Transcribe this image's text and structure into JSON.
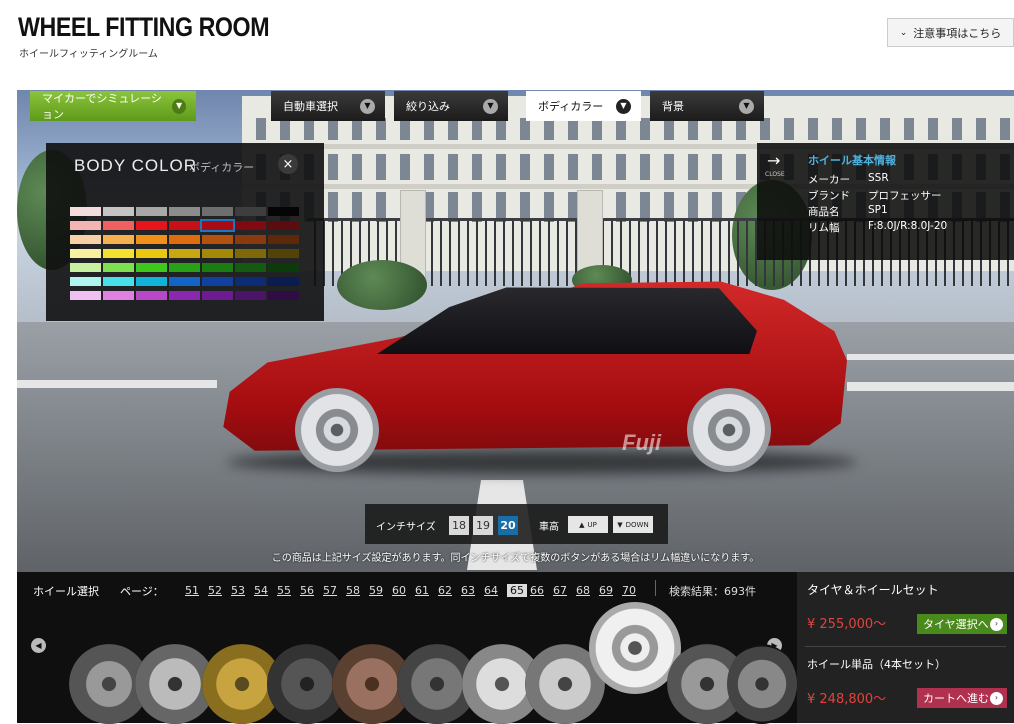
{
  "header": {
    "title": "WHEEL FITTING ROOM",
    "subtitle": "ホイールフィッティングルーム",
    "notice_button": "注意事項はこちら"
  },
  "nav": {
    "my_car_sim": "マイカーでシミュレーション",
    "tabs": [
      {
        "label": "自動車選択"
      },
      {
        "label": "絞り込み"
      },
      {
        "label": "ボディカラー",
        "active": true
      },
      {
        "label": "背景"
      }
    ]
  },
  "body_color": {
    "title": "BODY COLOR",
    "subtitle": "ボディカラー",
    "close": "×",
    "swatches": [
      [
        "#f2dcdc",
        "#c4c4c4",
        "#a8a8a8",
        "#8c8c8c",
        "#6e6e6e",
        "#3e3e3e",
        "#050505"
      ],
      [
        "#f4b4b4",
        "#f06060",
        "#e8141c",
        "#c8101a",
        "#a80c12",
        "#800a10",
        "#5a0c0e"
      ],
      [
        "#f8d0a8",
        "#f6b050",
        "#f09018",
        "#e06c10",
        "#b45010",
        "#8a3a0c",
        "#5e280a"
      ],
      [
        "#f8f0a0",
        "#f4e030",
        "#e8c810",
        "#c8a810",
        "#a48808",
        "#7e6808",
        "#524408"
      ],
      [
        "#c8f0a0",
        "#7ee050",
        "#3cc81c",
        "#28a018",
        "#1c7c14",
        "#145a10",
        "#0c3a0a"
      ],
      [
        "#b0f4f0",
        "#48e0e8",
        "#10b4d8",
        "#1464c8",
        "#1040a0",
        "#0c2c78",
        "#0a1c50"
      ],
      [
        "#f0c0f0",
        "#e080e0",
        "#b848c8",
        "#8c28b0",
        "#6c1c90",
        "#4c1468",
        "#300c44"
      ]
    ],
    "selected": "#a80c12"
  },
  "wheel_info": {
    "close_label": "CLOSE",
    "title": "ホイール基本情報",
    "rows": [
      {
        "label": "メーカー",
        "value": "SSR"
      },
      {
        "label": "ブランド",
        "value": "プロフェッサー"
      },
      {
        "label": "商品名",
        "value": "SP1"
      },
      {
        "label": "リム幅",
        "value": "F:8.0J/R:8.0J-20"
      }
    ]
  },
  "inch": {
    "label": "インチサイズ",
    "sizes": [
      "18",
      "19",
      "20"
    ],
    "selected": "20",
    "height_label": "車高",
    "up": "UP",
    "down": "DOWN"
  },
  "notice": "この商品は上記サイズ設定があります。同インチサイズで複数のボタンがある場合はリム幅違いになります。",
  "car": {
    "logo": "Fuji"
  },
  "selector": {
    "label": "ホイール選択",
    "page_label": "ページ：",
    "pages": [
      "51",
      "52",
      "53",
      "54",
      "55",
      "56",
      "57",
      "58",
      "59",
      "60",
      "61",
      "62",
      "63",
      "64",
      "65",
      "66",
      "67",
      "68",
      "69",
      "70"
    ],
    "current_page": "65",
    "results": "検索結果：693件"
  },
  "purchase": {
    "set_label": "タイヤ＆ホイールセット",
    "set_price": "¥ 255,000〜",
    "set_button": "タイヤ選択へ",
    "single_label": "ホイール単品（4本セット）",
    "single_price": "¥ 248,800〜",
    "single_button": "カートへ進む"
  },
  "colors": {
    "accent_blue": "#4fb3e0",
    "green": "#5e9a1a",
    "price_red": "#e0443d",
    "cart_pink": "#b03050"
  }
}
